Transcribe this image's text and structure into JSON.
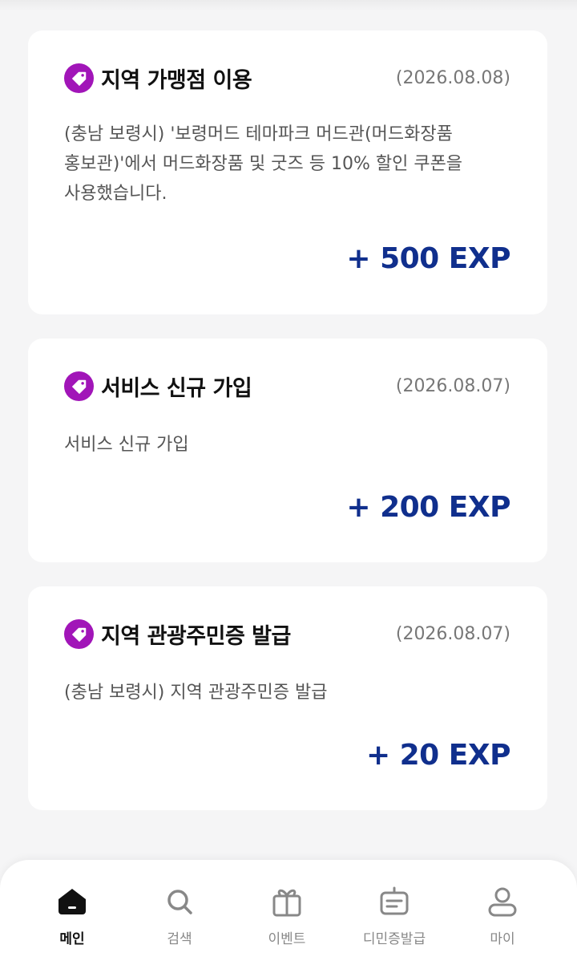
{
  "cards": [
    {
      "title": "지역 가맹점 이용",
      "date": "(2026.08.08)",
      "desc_lines": [
        "(충남 보령시) '보령머드 테마파크 머드관(머드화장품",
        "홍보관)'에서 머드화장품 및 굿즈 등 10% 할인 쿠폰을",
        "사용했습니다."
      ],
      "exp": "+ 500 EXP"
    },
    {
      "title": "서비스 신규 가입",
      "date": "(2026.08.07)",
      "desc_lines": [
        "서비스 신규 가입"
      ],
      "exp": "+ 200 EXP"
    },
    {
      "title": "지역 관광주민증 발급",
      "date": "(2026.08.07)",
      "desc_lines": [
        "(충남 보령시) 지역 관광주민증 발급"
      ],
      "exp": "+ 20 EXP"
    }
  ],
  "bottom_nav": [
    {
      "label": "메인",
      "icon": "home-icon",
      "active": true
    },
    {
      "label": "검색",
      "icon": "search-icon",
      "active": false
    },
    {
      "label": "이벤트",
      "icon": "gift-icon",
      "active": false
    },
    {
      "label": "디민증발급",
      "icon": "id-card-icon",
      "active": false
    },
    {
      "label": "마이",
      "icon": "user-icon",
      "active": false
    }
  ],
  "colors": {
    "background": "#f5f5f6",
    "tag_icon": "#a115b8",
    "exp_text": "#102f8d",
    "date_text": "#777777",
    "nav_inactive": "#888888",
    "nav_active": "#111111"
  }
}
